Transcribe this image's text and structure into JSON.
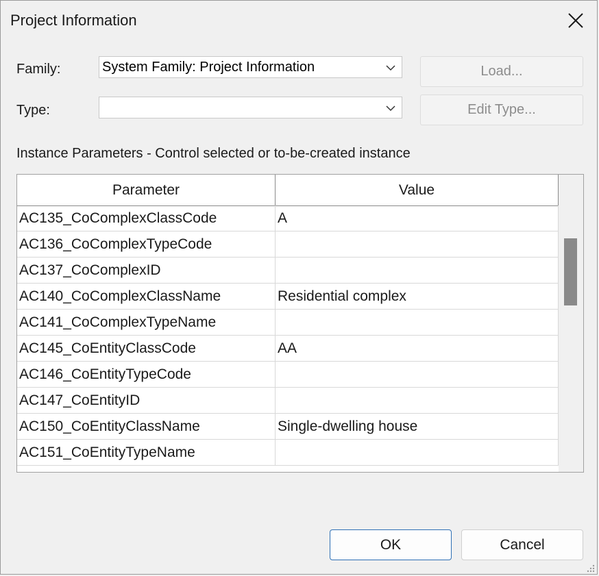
{
  "dialog": {
    "title": "Project Information",
    "close_icon": "close-icon"
  },
  "family": {
    "label": "Family:",
    "value": "System Family: Project Information"
  },
  "type": {
    "label": "Type:",
    "value": ""
  },
  "buttons": {
    "load": "Load...",
    "edit_type": "Edit Type...",
    "ok": "OK",
    "cancel": "Cancel"
  },
  "section": {
    "label": "Instance Parameters - Control selected or to-be-created instance"
  },
  "grid": {
    "columns": [
      "Parameter",
      "Value"
    ],
    "rows": [
      {
        "parameter": "AC135_CoComplexClassCode",
        "value": "A"
      },
      {
        "parameter": "AC136_CoComplexTypeCode",
        "value": ""
      },
      {
        "parameter": "AC137_CoComplexID",
        "value": ""
      },
      {
        "parameter": "AC140_CoComplexClassName",
        "value": "Residential complex"
      },
      {
        "parameter": "AC141_CoComplexTypeName",
        "value": ""
      },
      {
        "parameter": "AC145_CoEntityClassCode",
        "value": "AA"
      },
      {
        "parameter": "AC146_CoEntityTypeCode",
        "value": ""
      },
      {
        "parameter": "AC147_CoEntityID",
        "value": ""
      },
      {
        "parameter": "AC150_CoEntityClassName",
        "value": "Single-dwelling house"
      },
      {
        "parameter": "AC151_CoEntityTypeName",
        "value": ""
      }
    ]
  },
  "colors": {
    "background": "#f0f0f0",
    "default_button_border": "#2d6fb5",
    "disabled_text": "#8c8c8c",
    "scroll_thumb": "#8a8a8a"
  }
}
